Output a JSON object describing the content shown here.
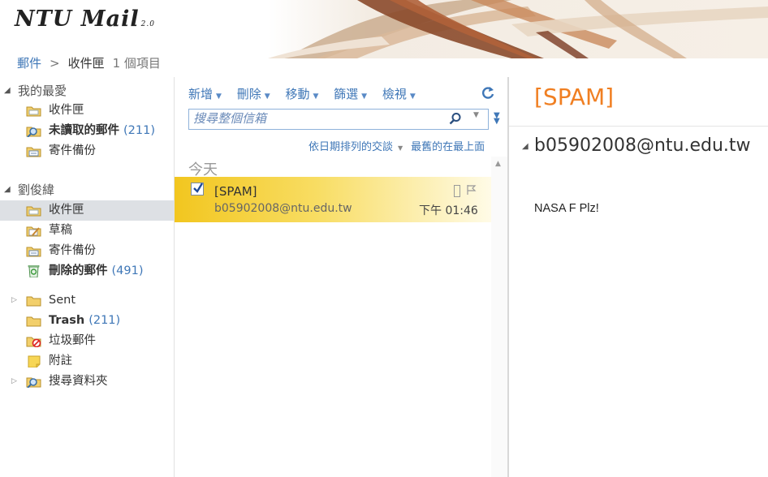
{
  "app": {
    "logo_text": "NTU Mail",
    "logo_version": "2.0"
  },
  "breadcrumb": {
    "root": "郵件",
    "separator": ">",
    "current": "收件匣",
    "count": "1 個項目"
  },
  "sidebar": {
    "favorites": {
      "title": "我的最愛",
      "items": [
        {
          "label": "收件匣",
          "count": "",
          "icon": "inbox-icon",
          "bold": false
        },
        {
          "label": "未讀取的郵件",
          "count": "(211)",
          "icon": "search-folder-icon",
          "bold": true
        },
        {
          "label": "寄件備份",
          "count": "",
          "icon": "sent-folder-icon",
          "bold": false
        }
      ]
    },
    "account": {
      "title": "劉俊緯",
      "items": [
        {
          "label": "收件匣",
          "count": "",
          "icon": "inbox-icon",
          "bold": false,
          "selected": true
        },
        {
          "label": "草稿",
          "count": "",
          "icon": "drafts-icon",
          "bold": false
        },
        {
          "label": "寄件備份",
          "count": "",
          "icon": "sent-folder-icon",
          "bold": false
        },
        {
          "label": "刪除的郵件",
          "count": "(491)",
          "icon": "recycle-bin-icon",
          "bold": true
        }
      ]
    },
    "folders": [
      {
        "label": "Sent",
        "count": "",
        "icon": "folder-icon",
        "bold": false,
        "expandable": true
      },
      {
        "label": "Trash",
        "count": "(211)",
        "icon": "folder-icon",
        "bold": true,
        "expandable": false
      },
      {
        "label": "垃圾郵件",
        "count": "",
        "icon": "junk-folder-icon",
        "bold": false,
        "expandable": false
      },
      {
        "label": "附註",
        "count": "",
        "icon": "notes-icon",
        "bold": false,
        "expandable": false
      },
      {
        "label": "搜尋資料夾",
        "count": "",
        "icon": "search-folder-icon",
        "bold": false,
        "expandable": true
      }
    ]
  },
  "toolbar": {
    "new": "新增",
    "delete": "刪除",
    "move": "移動",
    "filter": "篩選",
    "view": "檢視"
  },
  "search": {
    "placeholder": "搜尋整個信箱"
  },
  "sort": {
    "by": "依日期排列的交談",
    "order": "最舊的在最上面"
  },
  "list": {
    "group": "今天",
    "messages": [
      {
        "subject": "[SPAM]",
        "from": "b05902008@ntu.edu.tw",
        "time": "下午 01:46",
        "checked": true
      }
    ]
  },
  "reading": {
    "subject": "[SPAM]",
    "sender": "b05902008@ntu.edu.tw",
    "body": "NASA F Plz!"
  },
  "colors": {
    "accent_blue": "#3f77b7",
    "subject_orange": "#f07f22",
    "selected_row": "#f2c61f",
    "selected_folder": "#dde0e4"
  }
}
